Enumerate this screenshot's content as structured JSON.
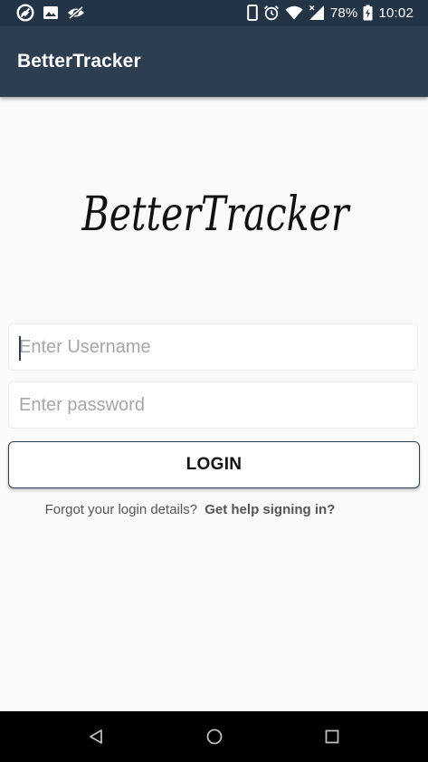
{
  "status_bar": {
    "left_icons": [
      "sync-disabled-icon",
      "image-icon",
      "eye-off-icon"
    ],
    "right_icons": [
      "phone-icon",
      "alarm-icon",
      "wifi-icon",
      "signal-icon"
    ],
    "battery_percent": "78%",
    "time": "10:02"
  },
  "app_bar": {
    "title": "BetterTracker"
  },
  "logo": {
    "text": "BetterTracker"
  },
  "login_form": {
    "username_placeholder": "Enter Username",
    "username_value": "",
    "password_placeholder": "Enter password",
    "password_value": "",
    "login_label": "LOGIN"
  },
  "help": {
    "prompt": "Forgot your login details?",
    "link": "Get help signing in?"
  },
  "nav_bar": {
    "buttons": [
      "back-icon",
      "home-icon",
      "recents-icon"
    ]
  },
  "colors": {
    "app_bar": "#2c3e50",
    "status_bar": "#243447",
    "background": "#fafafa",
    "nav_bar": "#000000"
  }
}
